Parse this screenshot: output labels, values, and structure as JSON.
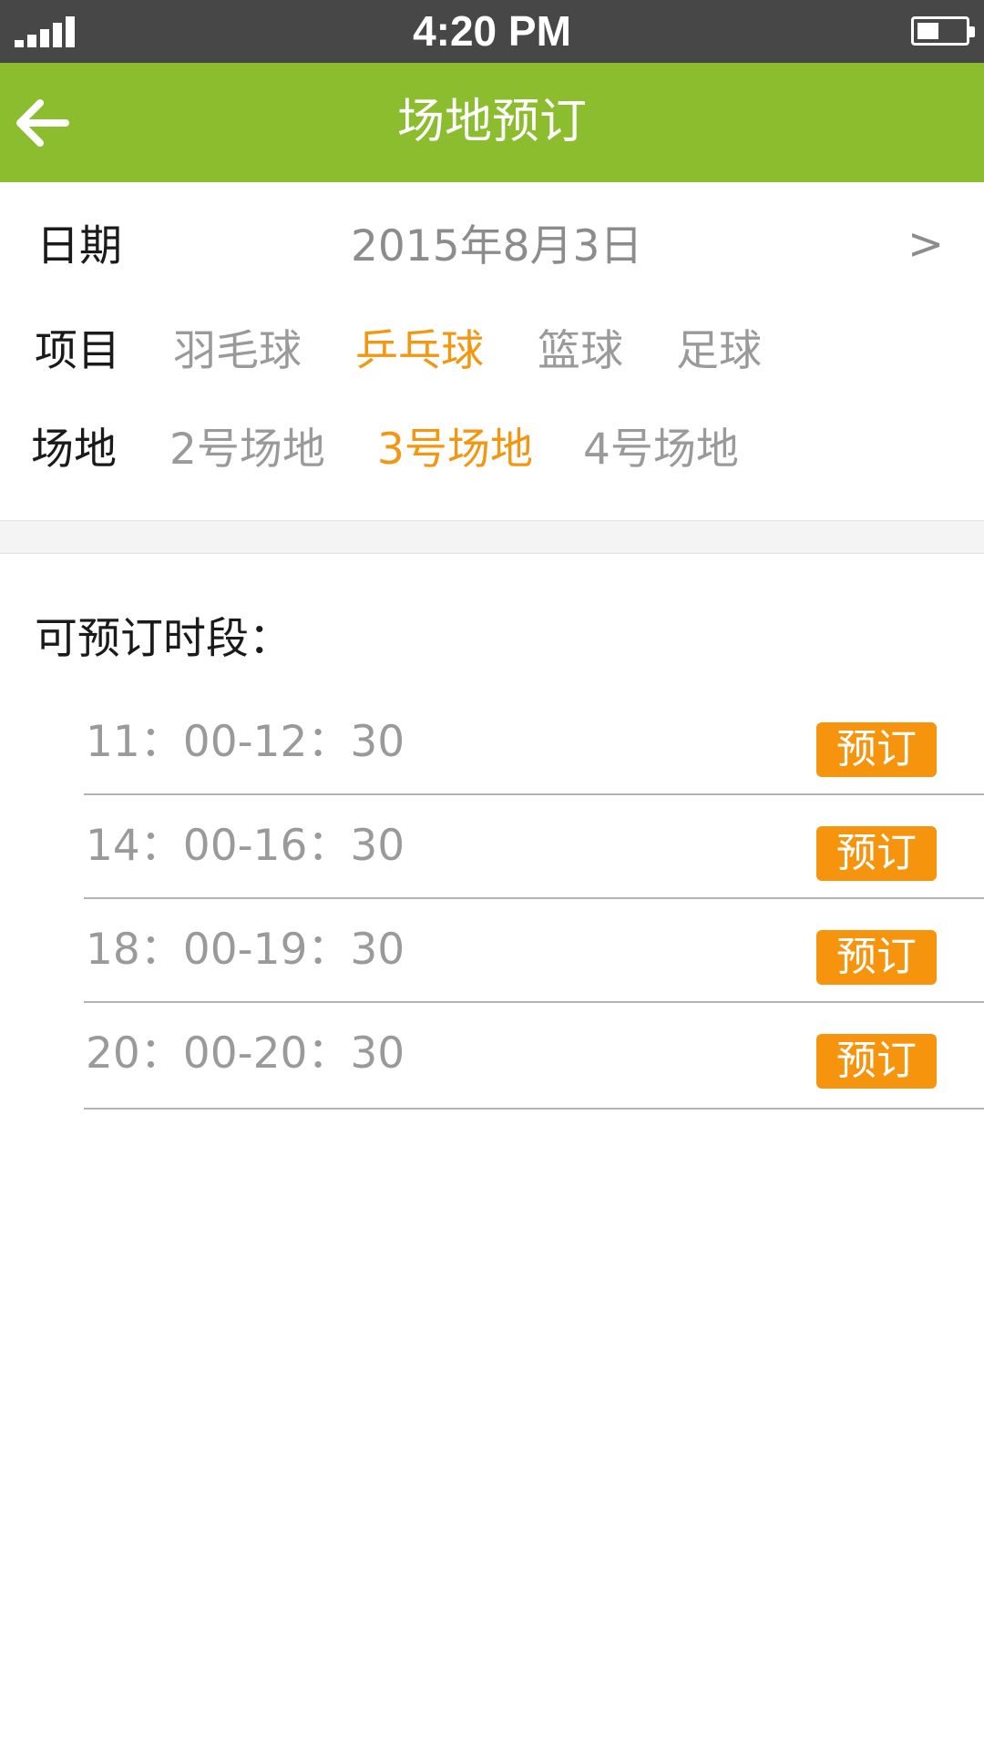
{
  "status_bar": {
    "time": "4:20 PM",
    "battery_level": 0.45
  },
  "nav": {
    "title": "场地预订",
    "back_icon": "arrow-left-icon"
  },
  "date": {
    "label": "日期",
    "value": "2015年8月3日",
    "next_symbol": ">"
  },
  "sport": {
    "label": "项目",
    "options": [
      "羽毛球",
      "乒乓球",
      "篮球",
      "足球"
    ],
    "selected": "乒乓球"
  },
  "court": {
    "label": "场地",
    "options": [
      "2号场地",
      "3号场地",
      "4号场地"
    ],
    "selected": "3号场地"
  },
  "slots": {
    "title": "可预订时段：",
    "items": [
      {
        "time": "11：00-12：30",
        "action": "预订"
      },
      {
        "time": "14：00-16：30",
        "action": "预订"
      },
      {
        "time": "18：00-19：30",
        "action": "预订"
      },
      {
        "time": "20：00-20：30",
        "action": "预订"
      }
    ]
  },
  "colors": {
    "nav": "#8bbd2f",
    "accent": "#f39712",
    "button": "#f7940e",
    "status_bar": "#474747"
  }
}
